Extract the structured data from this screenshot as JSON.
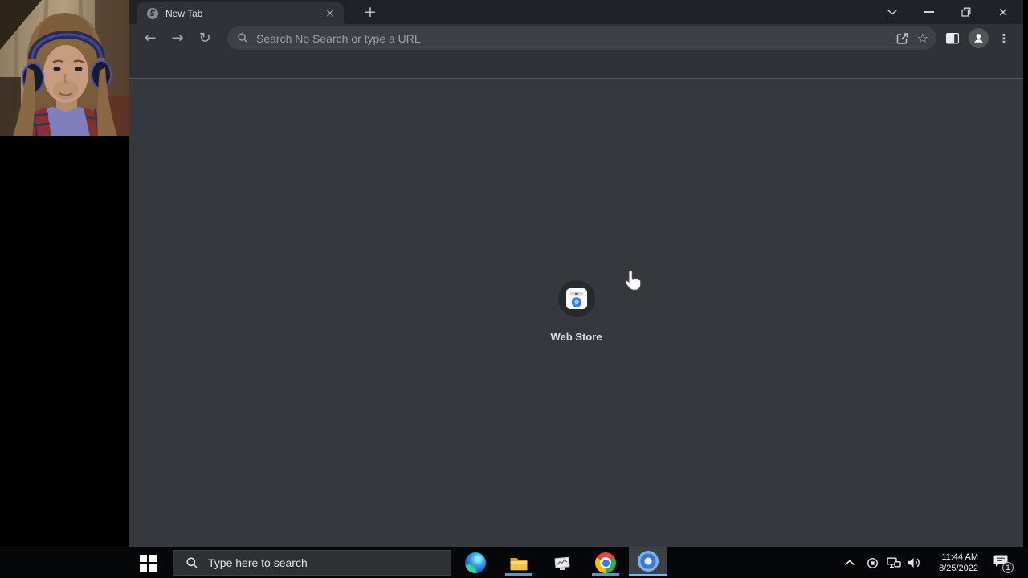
{
  "browser": {
    "tab": {
      "title": "New Tab"
    },
    "toolbar": {
      "address_placeholder": "Search No Search or type a URL"
    },
    "content": {
      "webstore_label": "Web Store"
    }
  },
  "taskbar": {
    "search_placeholder": "Type here to search",
    "clock_time": "11:44 AM",
    "clock_date": "8/25/2022",
    "notification_count": "1"
  },
  "glyphs": {
    "close": "×",
    "plus": "+",
    "back": "←",
    "forward": "→",
    "reload": "↻",
    "star": "☆",
    "menu_dots": "⋮"
  },
  "colors": {
    "frame": "#1f2226",
    "toolbar": "#2f3337",
    "omnibox": "#3d4146",
    "content": "#35393e",
    "divider": "#54585c",
    "taskbar": "#050709",
    "search_box": "#2e3033",
    "active_tile": "#3d4145",
    "underline_blue": "#4f9ad6",
    "underline_blue_bright": "#79b7e8",
    "webstore_blue": "#3e7de0",
    "text_primary": "#dee1e5",
    "text_muted": "#9aa0a6"
  },
  "icons": {
    "tab-favicon-icon": "gray globe swirl circle",
    "tab-close-icon": "x glyph",
    "new-tab-icon": "plus glyph",
    "tab-search-chevron-icon": "chevron down",
    "minimize-icon": "horizontal bar",
    "restore-icon": "overlapping squares",
    "close-icon": "x glyph",
    "back-icon": "left arrow",
    "forward-icon": "right arrow",
    "reload-icon": "circular arrow",
    "search-icon": "magnifier",
    "share-icon": "box with outgoing arrow",
    "bookmark-star-icon": "star outline",
    "side-panel-icon": "square with dark right pane",
    "profile-icon": "person in circle",
    "menu-icon": "three vertical dots",
    "webstore-logo-icon": "white tile with gray awning and blue ball",
    "hand-cursor-icon": "pointing hand",
    "windows-start-icon": "four white panes",
    "taskbar-search-icon": "magnifier",
    "edge-icon": "blue green swirl ball",
    "file-explorer-icon": "yellow folder",
    "task-manager-icon": "gray monitor with graph",
    "chrome-icon": "red yellow green ring with blue core",
    "chromium-icon": "blue ringed ball",
    "tray-chevron-up-icon": "chevron up",
    "tray-app-icon": "circle with square",
    "network-icon": "two monitors",
    "volume-icon": "speaker with waves",
    "action-center-icon": "speech bubble with badge"
  }
}
